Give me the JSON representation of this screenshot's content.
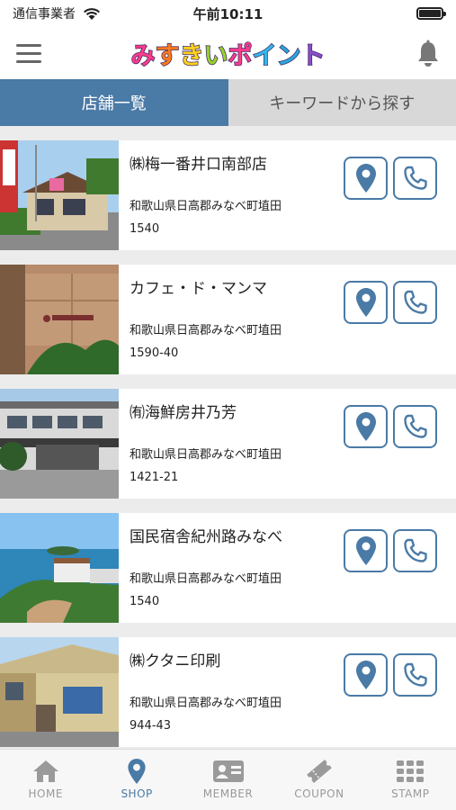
{
  "status_bar": {
    "carrier": "通信事業者",
    "time": "午前10:11"
  },
  "header": {
    "logo_chars": [
      "み",
      "す",
      "き",
      "い",
      "ポ",
      "イ",
      "ン",
      "ト"
    ],
    "logo_colors": [
      "#ff3b8a",
      "#ff7a1a",
      "#ffd21a",
      "#9ad12a",
      "#ff3b8a",
      "#35b6e8",
      "#2aa7d8",
      "#8a4cc8"
    ],
    "menu_icon": "hamburger-menu-icon",
    "bell_icon": "bell-icon"
  },
  "tabs": [
    {
      "label": "店舗一覧",
      "active": true
    },
    {
      "label": "キーワードから探す",
      "active": false
    }
  ],
  "shops": [
    {
      "name": "㈱梅一番井口南部店",
      "address": "和歌山県日高郡みなべ町埴田",
      "number": "1540"
    },
    {
      "name": "カフェ・ド・マンマ",
      "address": "和歌山県日高郡みなべ町埴田",
      "number": "1590-40"
    },
    {
      "name": "㈲海鮮房井乃芳",
      "address": "和歌山県日高郡みなべ町埴田",
      "number": "1421-21"
    },
    {
      "name": "国民宿舎紀州路みなべ",
      "address": "和歌山県日高郡みなべ町埴田",
      "number": "1540"
    },
    {
      "name": "㈱クタニ印刷",
      "address": "和歌山県日高郡みなべ町埴田",
      "number": "944-43"
    }
  ],
  "bottom_nav": [
    {
      "label": "HOME",
      "icon": "home-icon",
      "active": false
    },
    {
      "label": "SHOP",
      "icon": "map-pin-icon",
      "active": true
    },
    {
      "label": "MEMBER",
      "icon": "member-card-icon",
      "active": false
    },
    {
      "label": "COUPON",
      "icon": "coupon-ticket-icon",
      "active": false
    },
    {
      "label": "STAMP",
      "icon": "stamp-grid-icon",
      "active": false
    }
  ],
  "colors": {
    "accent": "#4a7aa6",
    "tab_inactive": "#d8d8d8",
    "background": "#ececec"
  }
}
